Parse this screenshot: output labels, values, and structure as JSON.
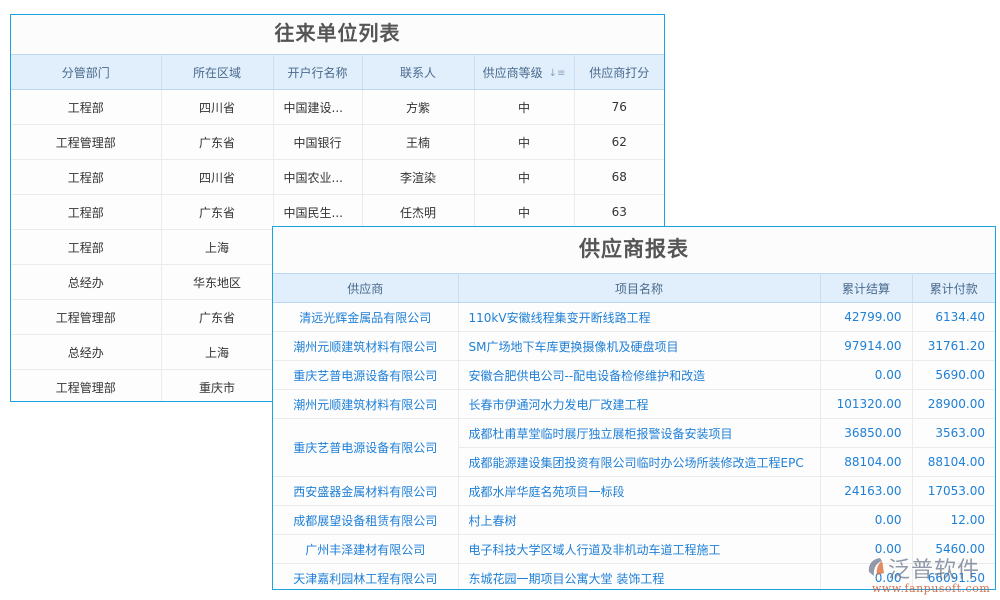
{
  "partner_list": {
    "title": "往来单位列表",
    "columns": [
      "分管部门",
      "所在区域",
      "开户行名称",
      "联系人",
      "供应商等级",
      "供应商打分"
    ],
    "sort_icon": "sort-descending-icon",
    "rows": [
      {
        "department": "工程部",
        "region": "四川省",
        "bank": "中国建设...",
        "contact": "方紫",
        "level": "中",
        "score": "76"
      },
      {
        "department": "工程管理部",
        "region": "广东省",
        "bank": "中国银行",
        "contact": "王楠",
        "level": "中",
        "score": "62"
      },
      {
        "department": "工程部",
        "region": "四川省",
        "bank": "中国农业...",
        "contact": "李渲染",
        "level": "中",
        "score": "68"
      },
      {
        "department": "工程部",
        "region": "广东省",
        "bank": "中国民生...",
        "contact": "任杰明",
        "level": "中",
        "score": "63"
      },
      {
        "department": "工程部",
        "region": "上海",
        "bank": "",
        "contact": "",
        "level": "",
        "score": ""
      },
      {
        "department": "总经办",
        "region": "华东地区",
        "bank": "",
        "contact": "",
        "level": "",
        "score": ""
      },
      {
        "department": "工程管理部",
        "region": "广东省",
        "bank": "",
        "contact": "",
        "level": "",
        "score": ""
      },
      {
        "department": "总经办",
        "region": "上海",
        "bank": "",
        "contact": "",
        "level": "",
        "score": ""
      },
      {
        "department": "工程管理部",
        "region": "重庆市",
        "bank": "",
        "contact": "",
        "level": "",
        "score": ""
      }
    ]
  },
  "supplier_report": {
    "title": "供应商报表",
    "columns": [
      "供应商",
      "项目名称",
      "累计结算",
      "累计付款"
    ],
    "rows": [
      {
        "supplier": "清远光辉金属品有限公司",
        "project": "110kV安徽线程集变开断线路工程",
        "settled": "42799.00",
        "paid": "6134.40"
      },
      {
        "supplier": "潮州元顺建筑材料有限公司",
        "project": "SM广场地下车库更换摄像机及硬盘项目",
        "settled": "97914.00",
        "paid": "31761.20"
      },
      {
        "supplier": "重庆艺普电源设备有限公司",
        "project": "安徽合肥供电公司--配电设备检修维护和改造",
        "settled": "0.00",
        "paid": "5690.00"
      },
      {
        "supplier": "潮州元顺建筑材料有限公司",
        "project": "长春市伊通河水力发电厂改建工程",
        "settled": "101320.00",
        "paid": "28900.00"
      },
      {
        "supplier": "重庆艺普电源设备有限公司",
        "project": "成都杜甫草堂临时展厅独立展柜报警设备安装项目",
        "settled": "36850.00",
        "paid": "3563.00"
      },
      {
        "supplier": "",
        "project": "成都能源建设集团投资有限公司临时办公场所装修改造工程EPC",
        "settled": "88104.00",
        "paid": "88104.00"
      },
      {
        "supplier": "西安盛器金属材料有限公司",
        "project": "成都水岸华庭名苑项目一标段",
        "settled": "24163.00",
        "paid": "17053.00"
      },
      {
        "supplier": "成都展望设备租赁有限公司",
        "project": "村上春树",
        "settled": "0.00",
        "paid": "12.00"
      },
      {
        "supplier": "广州丰泽建材有限公司",
        "project": "电子科技大学区域人行道及非机动车道工程施工",
        "settled": "0.00",
        "paid": "5460.00"
      },
      {
        "supplier": "天津嘉利园林工程有限公司",
        "project": "东城花园一期项目公寓大堂 装饰工程",
        "settled": "0.00",
        "paid": "66091.50"
      }
    ]
  },
  "watermark": {
    "brand": "泛普软件",
    "url": "www.fanpusoft.com",
    "logo_icon": "fanpu-logo-icon"
  },
  "colors": {
    "panel_border": "#1aa3e0",
    "header_bg": "#e1effc",
    "link_text": "#1e7fd6",
    "body_text": "#333333",
    "title_text": "#555555"
  }
}
